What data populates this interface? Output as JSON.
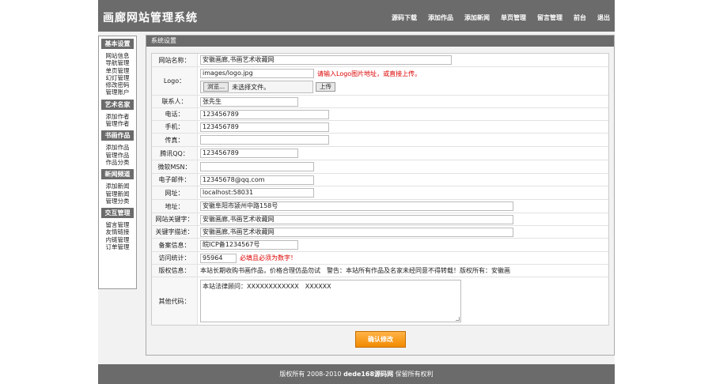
{
  "header": {
    "title": "画廊网站管理系统",
    "nav": [
      "源码下载",
      "添加作品",
      "添加新闻",
      "单页管理",
      "留言管理",
      "前台",
      "退出"
    ]
  },
  "sidebar": {
    "groups": [
      {
        "title": "基本设置",
        "items": [
          "网站信息",
          "导航管理",
          "单页管理",
          "幻灯管理",
          "修改密码",
          "管理账户"
        ]
      },
      {
        "title": "艺术名家",
        "items": [
          "添加作者",
          "管理作者"
        ]
      },
      {
        "title": "书画作品",
        "items": [
          "添加作品",
          "管理作品",
          "作品分类"
        ]
      },
      {
        "title": "新闻频道",
        "items": [
          "添加新闻",
          "管理新闻",
          "管理分类"
        ]
      },
      {
        "title": "交互管理",
        "items": [
          "留言管理",
          "友情链接",
          "内链管理",
          "订单管理"
        ]
      }
    ]
  },
  "panel": {
    "title": "系统设置"
  },
  "form": {
    "site_name": {
      "label": "网站名称：",
      "value": "安徽画廊,书画艺术收藏网"
    },
    "logo": {
      "label": "Logo：",
      "value": "images/logo.jpg",
      "hint": "请输入Logo图片地址，或直接上传。",
      "browse_label": "浏览...",
      "no_file": "未选择文件。",
      "upload_label": "上传"
    },
    "contact": {
      "label": "联系人：",
      "value": "张先生"
    },
    "phone": {
      "label": "电话：",
      "value": "123456789"
    },
    "mobile": {
      "label": "手机：",
      "value": "123456789"
    },
    "fax": {
      "label": "传真：",
      "value": ""
    },
    "qq": {
      "label": "腾讯QQ：",
      "value": "123456789"
    },
    "msn": {
      "label": "微软MSN：",
      "value": ""
    },
    "email": {
      "label": "电子邮件：",
      "value": "12345678@qq.com"
    },
    "url": {
      "label": "网址：",
      "value": "localhost:58031"
    },
    "address": {
      "label": "地址：",
      "value": "安徽阜阳市颍州中路158号"
    },
    "keywords": {
      "label": "网站关键字：",
      "value": "安徽画廊,书画艺术收藏网"
    },
    "description": {
      "label": "关键字描述：",
      "value": "安徽画廊,书画艺术收藏网"
    },
    "icp": {
      "label": "备案信息：",
      "value": "皖ICP备1234567号"
    },
    "stats": {
      "label": "访问统计：",
      "value": "95964",
      "hint": "必填且必须为数字！"
    },
    "copyright": {
      "label": "版权信息：",
      "value": "本站长期收购书画作品，价格合理仿品勿试　警告：本站所有作品及名家未经同意不得转载！版权所有：安徽画"
    },
    "other_code": {
      "label": "其他代码：",
      "value": "本站法律顾问：XXXXXXXXXXXX　XXXXXX"
    },
    "submit_label": "确认修改"
  },
  "footer": {
    "prefix": "版权所有 2008-2010 ",
    "brand": "dede168源码网",
    "suffix": " 保留所有权利"
  }
}
